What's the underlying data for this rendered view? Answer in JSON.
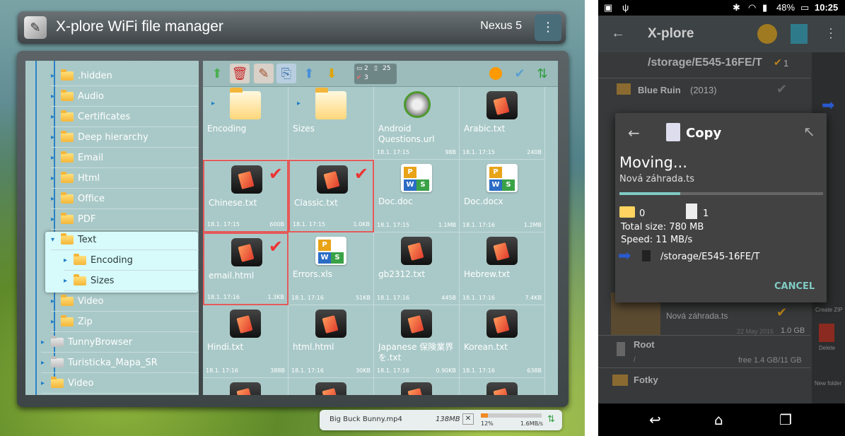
{
  "left": {
    "title": "X-plore WiFi file manager",
    "device": "Nexus 5",
    "tree": {
      "items": [
        {
          "label": ".hidden"
        },
        {
          "label": "Audio"
        },
        {
          "label": "Certificates"
        },
        {
          "label": "Deep hierarchy"
        },
        {
          "label": "Email"
        },
        {
          "label": "Html"
        },
        {
          "label": "Office"
        },
        {
          "label": "PDF"
        },
        {
          "label": "Text"
        },
        {
          "label": "Encoding"
        },
        {
          "label": "Sizes"
        },
        {
          "label": "Video"
        },
        {
          "label": "Zip"
        },
        {
          "label": "TunnyBrowser"
        },
        {
          "label": "Turisticka_Mapa_SR"
        },
        {
          "label": "Video"
        }
      ]
    },
    "toolbar": {
      "count_folders": "2",
      "count_files": "25",
      "count_checked": "3"
    },
    "files": [
      {
        "name": "Encoding",
        "date": "",
        "size": ""
      },
      {
        "name": "Sizes",
        "date": "",
        "size": ""
      },
      {
        "name": "Android Questions.url",
        "date": "18.1. 17:15",
        "size": "98B"
      },
      {
        "name": "Arabic.txt",
        "date": "18.1. 17:15",
        "size": "240B"
      },
      {
        "name": "Chinese.txt",
        "date": "18.1. 17:15",
        "size": "600B"
      },
      {
        "name": "Classic.txt",
        "date": "18.1. 17:15",
        "size": "1.0KB"
      },
      {
        "name": "Doc.doc",
        "date": "18.1. 17:15",
        "size": "1.1MB"
      },
      {
        "name": "Doc.docx",
        "date": "18.1. 17:16",
        "size": "1.2MB"
      },
      {
        "name": "email.html",
        "date": "18.1. 17:16",
        "size": "1.3KB"
      },
      {
        "name": "Errors.xls",
        "date": "18.1. 17:16",
        "size": "51KB"
      },
      {
        "name": "gb2312.txt",
        "date": "18.1. 17:16",
        "size": "445B"
      },
      {
        "name": "Hebrew.txt",
        "date": "18.1. 17:16",
        "size": "7.4KB"
      },
      {
        "name": "Hindi.txt",
        "date": "18.1. 17:16",
        "size": "388B"
      },
      {
        "name": "html.html",
        "date": "18.1. 17:16",
        "size": "30KB"
      },
      {
        "name": "Japanese 保険業界を.txt",
        "date": "18.1. 17:16",
        "size": "0.90KB"
      },
      {
        "name": "Korean.txt",
        "date": "18.1. 17:16",
        "size": "638B"
      }
    ],
    "transfer": {
      "file": "Big Buck Bunny.mp4",
      "size": "138MB",
      "percent": "12%",
      "progress": 0.12,
      "speed": "1.6MB/s"
    }
  },
  "right": {
    "status": {
      "battery": "48%",
      "time": "10:25"
    },
    "appbar_title": "X-plore",
    "path": "/storage/E545-16FE/T",
    "path_badge": "1",
    "rows": {
      "blue_ruin": "Blue Ruin",
      "blue_ruin_year": "(2013)",
      "nova": "Nová záhrada.ts",
      "nova_date": "22 May 2016",
      "nova_size": "1.0 GB",
      "root": "Root",
      "root_path": "/",
      "root_free": "free 1.4 GB/11 GB",
      "fotky": "Fotky"
    },
    "side_labels": [
      "Delete",
      "New folder",
      "Create ZIP"
    ],
    "dialog": {
      "title": "Copy",
      "status": "Moving...",
      "filename": "Nová záhrada.ts",
      "progress": 0.3,
      "folders": "0",
      "files": "1",
      "total_size": "Total size: 780 MB",
      "speed": "Speed: 11 MB/s",
      "destination": "/storage/E545-16FE/T",
      "cancel": "CANCEL"
    }
  }
}
